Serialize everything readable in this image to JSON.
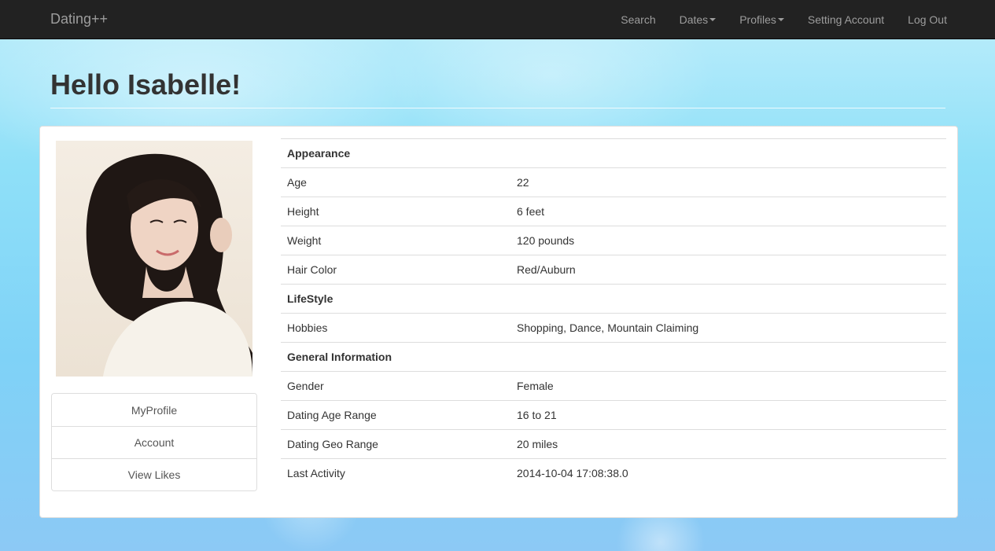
{
  "navbar": {
    "brand": "Dating++",
    "items": [
      {
        "label": "Search",
        "dropdown": false
      },
      {
        "label": "Dates",
        "dropdown": true
      },
      {
        "label": "Profiles",
        "dropdown": true
      },
      {
        "label": "Setting Account",
        "dropdown": false
      },
      {
        "label": "Log Out",
        "dropdown": false
      }
    ]
  },
  "header": {
    "title": "Hello Isabelle!"
  },
  "sidebar": {
    "items": [
      {
        "label": "MyProfile"
      },
      {
        "label": "Account"
      },
      {
        "label": "View Likes"
      }
    ]
  },
  "profile": {
    "appearance_heading": "Appearance",
    "age": {
      "label": "Age",
      "value": "22"
    },
    "height": {
      "label": "Height",
      "value": "6 feet"
    },
    "weight": {
      "label": "Weight",
      "value": "120 pounds"
    },
    "hair_color": {
      "label": "Hair Color",
      "value": "Red/Auburn"
    },
    "lifestyle_heading": "LifeStyle",
    "hobbies": {
      "label": "Hobbies",
      "value": "Shopping, Dance, Mountain Claiming"
    },
    "general_heading": "General Information",
    "gender": {
      "label": "Gender",
      "value": "Female"
    },
    "dating_age_range": {
      "label": "Dating Age Range",
      "value": "16 to 21"
    },
    "dating_geo_range": {
      "label": "Dating Geo Range",
      "value": "20 miles"
    },
    "last_activity": {
      "label": "Last Activity",
      "value": "2014-10-04 17:08:38.0"
    }
  },
  "colors": {
    "navbar_bg": "#222222",
    "nav_text": "#9d9d9d",
    "panel_bg": "#ffffff"
  }
}
